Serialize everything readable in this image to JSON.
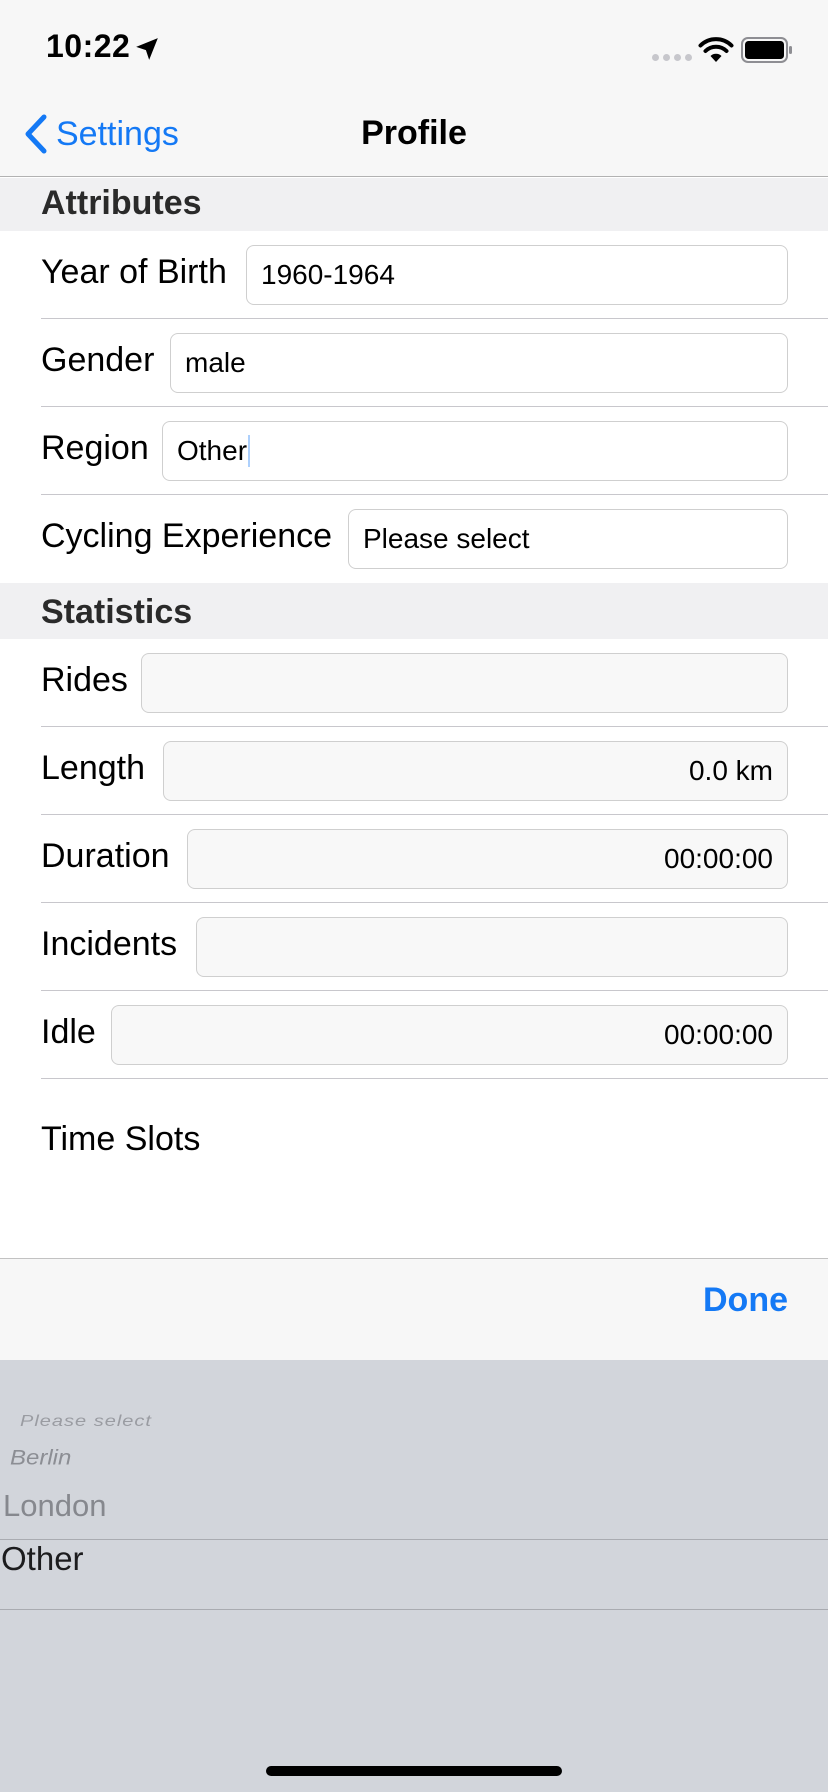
{
  "status_bar": {
    "time": "10:22"
  },
  "nav": {
    "back_label": "Settings",
    "title": "Profile"
  },
  "attributes": {
    "header": "Attributes",
    "rows": [
      {
        "label": "Year of Birth",
        "value": "1960-1964"
      },
      {
        "label": "Gender",
        "value": "male"
      },
      {
        "label": "Region",
        "value": "Other"
      },
      {
        "label": "Cycling Experience",
        "value": "Please select"
      }
    ]
  },
  "statistics": {
    "header": "Statistics",
    "rows": [
      {
        "label": "Rides",
        "value": ""
      },
      {
        "label": "Length",
        "value": "0.0 km"
      },
      {
        "label": "Duration",
        "value": "00:00:00"
      },
      {
        "label": "Incidents",
        "value": ""
      },
      {
        "label": "Idle",
        "value": "00:00:00"
      }
    ]
  },
  "time_slots_label": "Time Slots",
  "toolbar": {
    "done_label": "Done"
  },
  "picker": {
    "options": [
      "Please select",
      "Berlin",
      "London",
      "Other"
    ],
    "selected": "Other"
  },
  "colors": {
    "accent": "#1479f5",
    "picker_bg": "#d2d5db",
    "section_bg": "#f0f0f2"
  }
}
